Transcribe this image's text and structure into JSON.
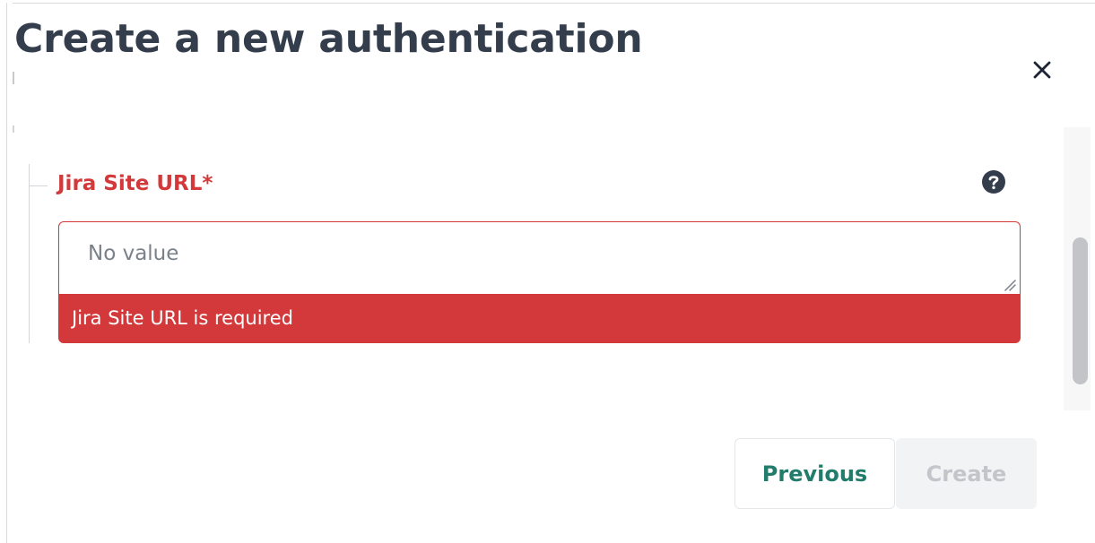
{
  "dialog": {
    "title": "Create a new authentication",
    "close_icon": "close-icon"
  },
  "field": {
    "label": "Jira Site URL*",
    "placeholder": "No value",
    "value": "",
    "help_icon": "question-circle-icon",
    "error": "Jira Site URL is required"
  },
  "buttons": {
    "previous": "Previous",
    "create": "Create"
  },
  "colors": {
    "title": "#333d4b",
    "error": "#d3393a",
    "accent": "#227c6c",
    "disabled_text": "#c2c5c9",
    "disabled_bg": "#f2f3f4"
  }
}
